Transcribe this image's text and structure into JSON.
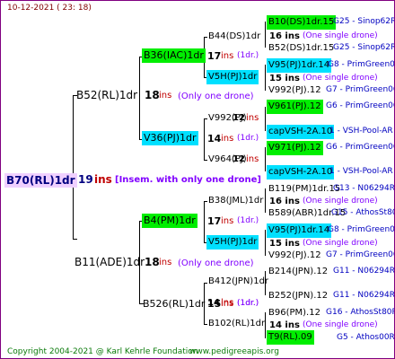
{
  "header": {
    "date": "10-12-2021 ( 23: 18)"
  },
  "root": {
    "name": "B70(RL)1dr",
    "ins_num": "19",
    "ins_word": "ins",
    "note": "[Insem. with only one drone]"
  },
  "gen1": [
    {
      "name": "B52(RL)1dr",
      "ins_num": "18",
      "ins_word": "ins",
      "note": "(Only one drone)"
    },
    {
      "name": "B11(ADE)1dr",
      "ins_num": "18",
      "ins_word": "ins",
      "note": "(Only one drone)"
    }
  ],
  "gen2": [
    {
      "name": "B36(IAC)1dr",
      "ins_num": "17",
      "ins_word": "ins",
      "note": "(1dr.)"
    },
    {
      "name": "V36(PJ)1dr",
      "ins_num": "14",
      "ins_word": "ins",
      "note": "(1dr.)"
    },
    {
      "name": "B4(PM)1dr",
      "ins_num": "17",
      "ins_word": "ins",
      "note": "(1dr.)"
    },
    {
      "name": "B526(RL)1dr",
      "ins_num": "15",
      "ins_word": "ins",
      "note": "(1dr.)"
    }
  ],
  "gen3": [
    {
      "name": "B44(DS)1dr",
      "ins_num": "",
      "ins_word": "",
      "note": ""
    },
    {
      "name": "V5H(PJ)1dr",
      "ins_num": "",
      "ins_word": "",
      "note": ""
    },
    {
      "name": "V992(PJ)",
      "ins_num": "12",
      "ins_word": "ins",
      "note": ""
    },
    {
      "name": "V964(PJ)",
      "ins_num": "12",
      "ins_word": "ins",
      "note": ""
    },
    {
      "name": "B38(JML)1dr",
      "ins_num": "",
      "ins_word": "",
      "note": ""
    },
    {
      "name": "V5H(PJ)1dr",
      "ins_num": "",
      "ins_word": "",
      "note": ""
    },
    {
      "name": "B412(JPN)1dr",
      "ins_num": "14",
      "ins_word": "ins",
      "note": "(1dr.)"
    },
    {
      "name": "B102(RL)1dr",
      "ins_num": "",
      "ins_word": "",
      "note": ""
    }
  ],
  "gen4": [
    {
      "a": "B10(DS)1dr.15",
      "a_code": "G25 - Sinop62R",
      "b": "16 ins",
      "b_note": "(One single drone)",
      "c": "B52(DS)1dr.15",
      "c_code": "G25 - Sinop62R"
    },
    {
      "a": "V95(PJ)1dr.14",
      "a_code": "G8 - PrimGreen00",
      "b": "15 ins",
      "b_note": "(One single drone)",
      "c": "V992(PJ).12",
      "c_code": "G7 - PrimGreen00"
    },
    {
      "a": "V961(PJ).12",
      "a_code": "G6 - PrimGreen00",
      "b": "",
      "b_note": "",
      "c": "capVSH-2A.10",
      "c_code": "1 - VSH-Pool-AR"
    },
    {
      "a": "V971(PJ).12",
      "a_code": "G6 - PrimGreen00",
      "b": "",
      "b_note": "",
      "c": "capVSH-2A.10",
      "c_code": "1 - VSH-Pool-AR"
    },
    {
      "a": "B119(PM)1dr.15",
      "a_code": "G13 - N06294R",
      "b": "16 ins",
      "b_note": "(One single drone)",
      "c": "B589(ABR)1dr.15",
      "c_code": "G15 - AthosSt80R"
    },
    {
      "a": "V95(PJ)1dr.14",
      "a_code": "G8 - PrimGreen00",
      "b": "15 ins",
      "b_note": "(One single drone)",
      "c": "V992(PJ).12",
      "c_code": "G7 - PrimGreen00"
    },
    {
      "a": "B214(JPN).12",
      "a_code": "G11 - N06294R",
      "b": "",
      "b_note": "",
      "c": "B252(JPN).12",
      "c_code": "G11 - N06294R"
    },
    {
      "a": "B96(PM).12",
      "a_code": "G16 - AthosSt80R",
      "b": "14 ins",
      "b_note": "(One single drone)",
      "c": "T9(RL).09",
      "c_code": "G5 - Athos00R"
    }
  ],
  "footer": {
    "copyright": "Copyright 2004-2021 @ Karl Kehrle Foundation",
    "url": "www.pedigreeapis.org"
  }
}
